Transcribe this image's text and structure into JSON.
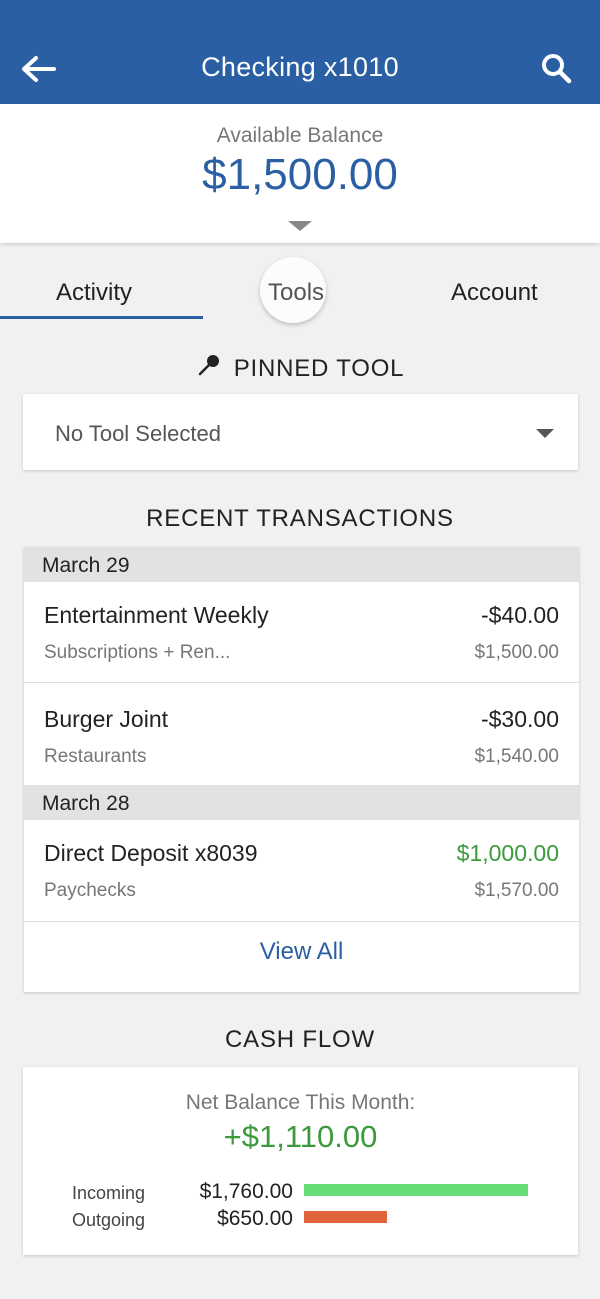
{
  "header": {
    "title": "Checking x1010",
    "back_icon": "back-arrow-icon",
    "search_icon": "search-icon",
    "color": "#2a5fa3"
  },
  "balance": {
    "label": "Available Balance",
    "amount": "$1,500.00"
  },
  "tabs": [
    {
      "label": "Activity",
      "active": true
    },
    {
      "label": "Tools",
      "active": false
    },
    {
      "label": "Account",
      "active": false
    }
  ],
  "pinned_tool": {
    "heading": "PINNED TOOL",
    "icon": "pin-icon",
    "selected": "No Tool Selected"
  },
  "transactions": {
    "heading": "RECENT TRANSACTIONS",
    "groups": [
      {
        "date": "March 29",
        "items": [
          {
            "name": "Entertainment Weekly",
            "category": "Subscriptions + Ren...",
            "amount": "-$40.00",
            "balance": "$1,500.00"
          },
          {
            "name": "Burger Joint",
            "category": "Restaurants",
            "amount": "-$30.00",
            "balance": "$1,540.00"
          }
        ]
      },
      {
        "date": "March 28",
        "items": [
          {
            "name": "Direct Deposit x8039",
            "category": "Paychecks",
            "amount": "$1,000.00",
            "balance": "$1,570.00"
          }
        ]
      }
    ],
    "view_all": "View All"
  },
  "cash_flow": {
    "heading": "CASH FLOW",
    "net_label": "Net Balance This Month:",
    "net_amount": "+$1,110.00",
    "incoming_label": "Incoming",
    "incoming_value": "$1,760.00",
    "incoming_fraction": 1.0,
    "incoming_color": "#66dd77",
    "outgoing_label": "Outgoing",
    "outgoing_value": "$650.00",
    "outgoing_fraction": 0.369,
    "outgoing_color": "#e2643a"
  }
}
